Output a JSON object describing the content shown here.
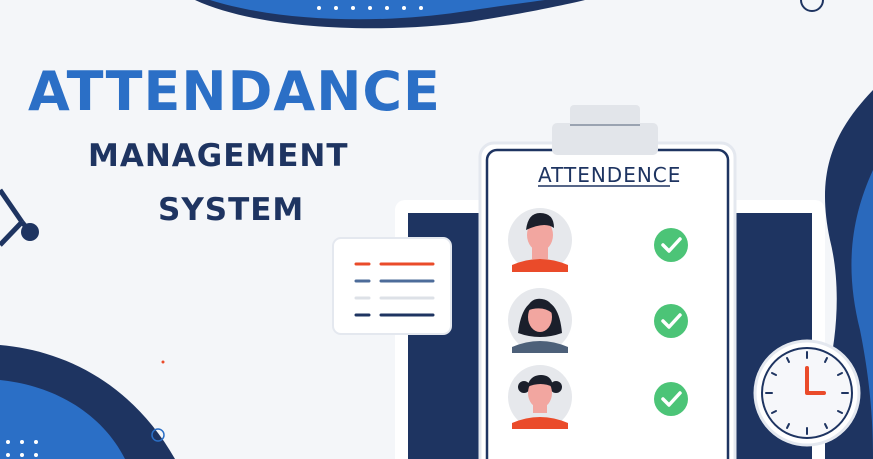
{
  "headline": {
    "title": "ATTENDANCE",
    "line1": "MANAGEMENT",
    "line2": "SYSTEM"
  },
  "clipboard": {
    "title": "ATTENDENCE",
    "rows": [
      {
        "person": "man",
        "status": "check"
      },
      {
        "person": "woman-long-hair",
        "status": "check"
      },
      {
        "person": "woman-pigtails",
        "status": "check"
      }
    ]
  },
  "colors": {
    "brand_blue": "#2b6fc6",
    "navy": "#1e3461",
    "check_green": "#4cc477",
    "accent_orange": "#ea4b2a"
  },
  "icons": [
    "clock-icon",
    "checkmark-icon",
    "list-icon",
    "molecule-icon",
    "ring-icon"
  ]
}
